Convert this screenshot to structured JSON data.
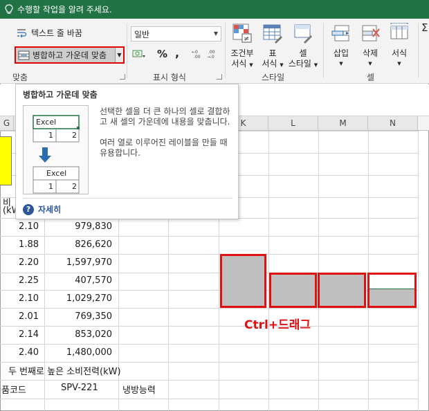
{
  "tell_me": {
    "text": "수행할 작업을 알려 주세요."
  },
  "ribbon": {
    "wrap_text": "텍스트 줄 바꿈",
    "merge_center": "병합하고 가운데 맞춤",
    "align_group": "맞춤",
    "number_format_value": "일반",
    "number_group": "표시 형식",
    "percent_glyph": "%",
    "comma_glyph": ",",
    "conditional": {
      "line1": "조건부",
      "line2": "서식"
    },
    "format_table": {
      "line1": "표",
      "line2": "서식"
    },
    "cell_styles": {
      "line1": "셀",
      "line2": "스타일"
    },
    "styles_group": "스타일",
    "insert": "삽입",
    "delete": "삭제",
    "format": "서식",
    "cells_group": "셀"
  },
  "tooltip": {
    "title": "병합하고 가운데 맞춤",
    "desc1": "선택한 셀을 더 큰 하나의 셀로 결합하고 새 셀의 가운데에 내용을 맞춥니다.",
    "desc2": "여러 열로 이루어진 레이블을 만들 때 유용합니다.",
    "more": "자세히",
    "illustration": {
      "excel_top": "Excel",
      "n1": "1",
      "n2": "2",
      "excel_bottom": "Excel",
      "n3": "1",
      "n4": "2"
    }
  },
  "columns": [
    "G",
    "K",
    "L",
    "M",
    "N"
  ],
  "header_partial": {
    "line1": "비",
    "line2": "(kW"
  },
  "rows": [
    {
      "a": "2.10",
      "b": "979,830"
    },
    {
      "a": "1.88",
      "b": "826,620"
    },
    {
      "a": "2.20",
      "b": "1,597,970"
    },
    {
      "a": "2.25",
      "b": "407,570"
    },
    {
      "a": "2.10",
      "b": "1,029,270"
    },
    {
      "a": "2.01",
      "b": "769,350"
    },
    {
      "a": "2.14",
      "b": "853,020"
    },
    {
      "a": "2.40",
      "b": "1,480,000"
    }
  ],
  "second_highest": "두 번째로 높은 소비전력(kW)",
  "bottom_row": {
    "c1": "품코드",
    "c2": "SPV-221",
    "c3": "냉방능력"
  },
  "annotation": "Ctrl+드래그",
  "colors": {
    "excel_green": "#217346",
    "highlight_red": "#e01010",
    "yellow": "#ffff00"
  }
}
